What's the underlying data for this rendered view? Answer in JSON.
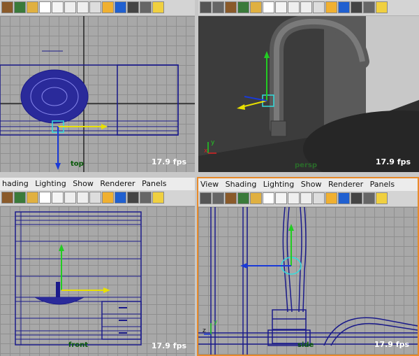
{
  "menu": [
    "View",
    "Shading",
    "Lighting",
    "Show",
    "Renderer",
    "Panels"
  ],
  "menu_truncated": [
    "hading",
    "Lighting",
    "Show",
    "Renderer",
    "Panels"
  ],
  "panes": {
    "top": {
      "label": "top",
      "fps": "17.9 fps"
    },
    "persp": {
      "label": "persp",
      "fps": "17.9 fps"
    },
    "front": {
      "label": "front",
      "fps": "17.9 fps"
    },
    "side": {
      "label": "side",
      "fps": "17.9 fps"
    }
  },
  "axis": {
    "y": "y",
    "z": "z",
    "x": "x"
  },
  "colors": {
    "wire": "#1a1a8a",
    "y_axis": "#22cc22",
    "x_axis": "#e8e000",
    "z_axis": "#1a3ad8",
    "active_border": "#e88a2a"
  },
  "toolbar_icons": [
    "camera-icon",
    "film-icon",
    "book-icon",
    "layers-icon",
    "eye-icon",
    "grid-icon",
    "cube-wire-icon",
    "cube-solid-icon",
    "light-bulb-icon"
  ]
}
